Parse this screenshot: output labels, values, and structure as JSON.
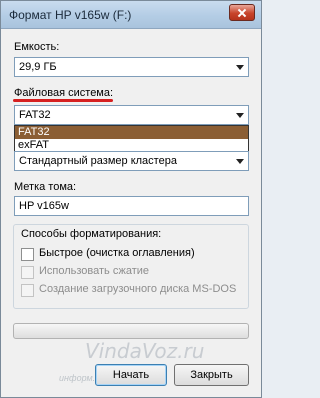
{
  "window": {
    "title": "Формат HP v165w (F:)"
  },
  "capacity": {
    "label": "Емкость:",
    "value": "29,9 ГБ"
  },
  "filesystem": {
    "label": "Файловая система:",
    "value": "FAT32",
    "options": [
      "FAT32",
      "exFAT"
    ]
  },
  "cluster": {
    "value": "Стандартный размер кластера"
  },
  "volume": {
    "label": "Метка тома:",
    "value": "HP v165w"
  },
  "format_options": {
    "title": "Способы форматирования:",
    "items": [
      {
        "label": "Быстрое (очистка оглавления)",
        "checked": false,
        "enabled": true
      },
      {
        "label": "Использовать сжатие",
        "checked": false,
        "enabled": false
      },
      {
        "label": "Создание загрузочного диска MS-DOS",
        "checked": false,
        "enabled": false
      }
    ]
  },
  "progress": {
    "value": 0
  },
  "buttons": {
    "start": "Начать",
    "close": "Закрыть"
  },
  "watermark": {
    "brand": "VindaVoz.ru",
    "sub": "информ..."
  },
  "colors": {
    "selected_option": "#8b5e34",
    "annotation": "#d62020"
  }
}
